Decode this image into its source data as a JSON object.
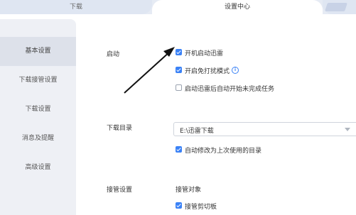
{
  "tabs": {
    "download": "下载",
    "settings": "设置中心"
  },
  "sidebar": {
    "items": [
      {
        "label": "基本设置",
        "active": true
      },
      {
        "label": "下载接管设置",
        "active": false
      },
      {
        "label": "下载设置",
        "active": false
      },
      {
        "label": "消息及提醒",
        "active": false
      },
      {
        "label": "高级设置",
        "active": false
      }
    ]
  },
  "startup": {
    "label": "启动",
    "options": [
      {
        "label": "开机启动迅雷",
        "checked": true
      },
      {
        "label": "开启免打扰模式",
        "checked": true,
        "icon": "info-icon"
      },
      {
        "label": "启动迅雷后自动开始未完成任务",
        "checked": false
      }
    ]
  },
  "download_dir": {
    "label": "下载目录",
    "value": "E:\\迅雷下载",
    "auto_modify": {
      "label": "自动修改为上次使用的目录",
      "checked": true
    }
  },
  "takeover": {
    "label": "接管设置",
    "target_label": "接管对象",
    "options": [
      {
        "label": "接管剪切板",
        "checked": true
      }
    ]
  },
  "colors": {
    "accent": "#3b82f6",
    "sidebar_bg": "#eef0f5",
    "sidebar_active": "#dde1ea"
  }
}
